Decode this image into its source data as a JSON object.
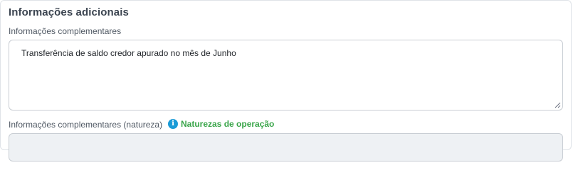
{
  "section": {
    "title": "Informações adicionais"
  },
  "complementary_info": {
    "label": "Informações complementares",
    "value": "Transferência de saldo credor apurado no mês de Junho"
  },
  "nature_info": {
    "label": "Informações complementares (natureza)",
    "link_icon": "info-icon",
    "link_label": "Naturezas de operação",
    "value": ""
  },
  "colors": {
    "link_green": "#3aa54a",
    "info_blue": "#1a9bd7",
    "title": "#3b4450"
  }
}
